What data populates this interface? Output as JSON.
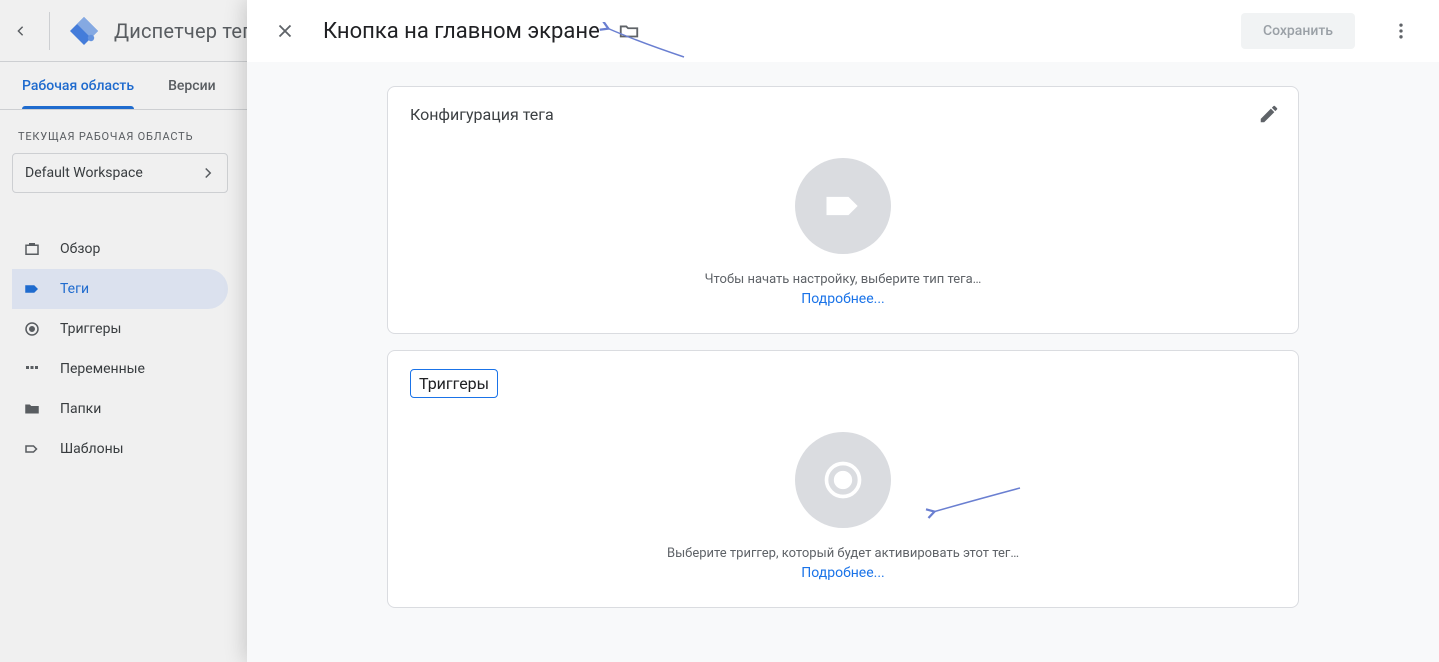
{
  "background": {
    "app_title": "Диспетчер тегов",
    "tabs": {
      "workspace": "Рабочая область",
      "versions": "Версии"
    },
    "workspace_label": "ТЕКУЩАЯ РАБОЧАЯ ОБЛАСТЬ",
    "workspace_name": "Default Workspace",
    "nav": {
      "overview": "Обзор",
      "tags": "Теги",
      "triggers": "Триггеры",
      "variables": "Переменные",
      "folders": "Папки",
      "templates": "Шаблоны"
    }
  },
  "panel": {
    "title": "Кнопка на главном экране",
    "save_label": "Сохранить",
    "tag_config": {
      "heading": "Конфигурация тега",
      "empty_text": "Чтобы начать настройку, выберите тип тега…",
      "learn_more": "Подробнее..."
    },
    "triggers": {
      "heading": "Триггеры",
      "empty_text": "Выберите триггер, который будет активировать этот тег…",
      "learn_more": "Подробнее..."
    }
  }
}
